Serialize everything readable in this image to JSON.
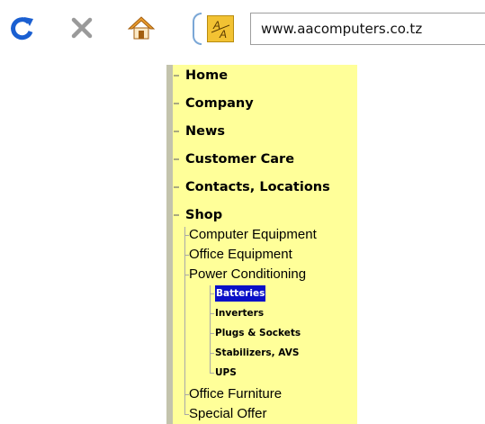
{
  "browser": {
    "url": "www.aacomputers.co.tz",
    "site_icon_text": "A"
  },
  "menu": {
    "items": [
      {
        "label": "Home"
      },
      {
        "label": "Company"
      },
      {
        "label": "News"
      },
      {
        "label": "Customer Care"
      },
      {
        "label": "Contacts, Locations"
      },
      {
        "label": "Shop"
      }
    ],
    "shop": [
      {
        "label": "Computer Equipment"
      },
      {
        "label": "Office Equipment"
      },
      {
        "label": "Power Conditioning"
      },
      {
        "label": "Office Furniture"
      },
      {
        "label": "Special Offer"
      }
    ],
    "power_conditioning": [
      {
        "label": "Batteries",
        "selected": true
      },
      {
        "label": "Inverters"
      },
      {
        "label": "Plugs & Sockets"
      },
      {
        "label": "Stabilizers, AVS"
      },
      {
        "label": "UPS"
      }
    ]
  },
  "colors": {
    "menu_background": "#ffff99",
    "selected_background": "#0a10c8",
    "reload_icon": "#1a5fd1",
    "stop_icon": "#9a9a9a"
  }
}
